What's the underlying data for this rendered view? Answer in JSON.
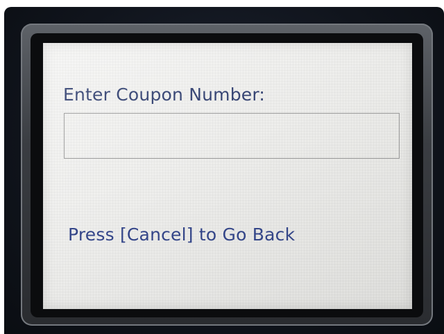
{
  "screen": {
    "prompt_label": "Enter Coupon Number:",
    "coupon_input_value": "",
    "back_hint": "Press [Cancel] to Go Back"
  },
  "colors": {
    "text": "#2e3d6e",
    "hint_text": "#34468a",
    "screen_background": "#eeeeec",
    "bezel": "#0b0c0e"
  }
}
